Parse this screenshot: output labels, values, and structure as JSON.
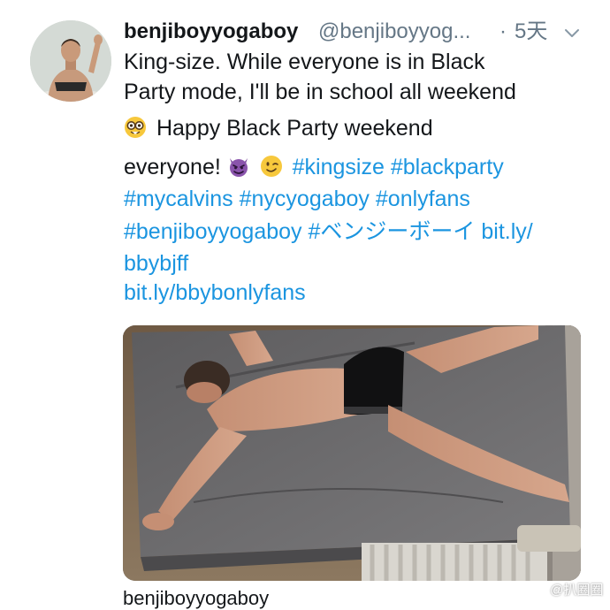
{
  "tweet": {
    "display_name": "benjiboyyogaboy",
    "handle": "@benjiboyyog...",
    "separator": "·",
    "time": "5天",
    "lines": {
      "l1": "King-size. While everyone is in Black",
      "l2": "Party mode, I'll be in school all weekend",
      "l3": "Happy Black Party weekend",
      "l4_text": "everyone!",
      "l4_tag1": "#kingsize",
      "l4_tag2": "#blackparty",
      "l5_tag1": "#mycalvins",
      "l5_tag2": "#nycyogaboy",
      "l5_tag3": "#onlyfans",
      "l6_tag1": "#benjiboyyogaboy",
      "l6_tag2": "#ベンジーボーイ",
      "l6_link": "bit.ly/",
      "l7_link": "bbybjff",
      "l8_link": "bit.ly/bbybonlyfans"
    },
    "emojis": [
      "nerd-face-emoji",
      "smiling-imp-emoji",
      "winking-face-emoji"
    ],
    "card_title": "benjiboyyogaboy"
  },
  "watermark": {
    "text": "@扒圈圈"
  },
  "colors": {
    "link": "#1b95e0",
    "secondary": "#657786",
    "text": "#14171a"
  }
}
